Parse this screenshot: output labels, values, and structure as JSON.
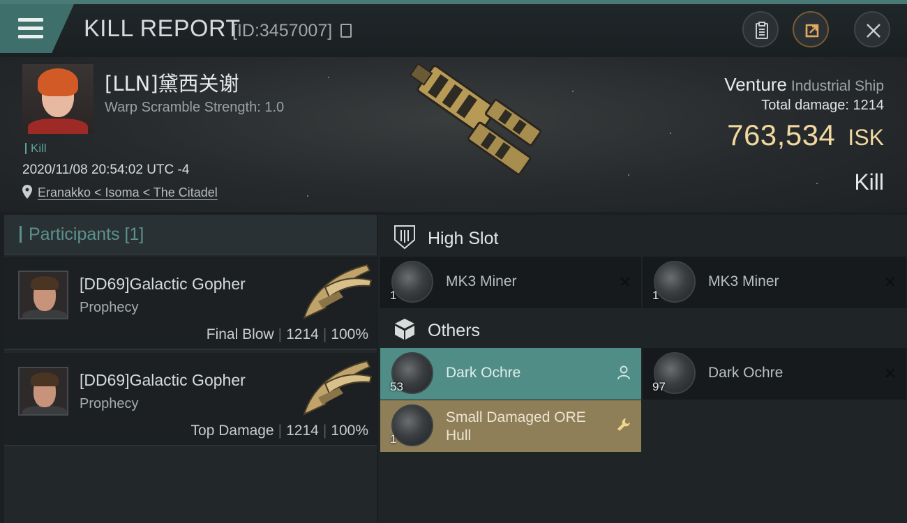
{
  "header": {
    "title": "KILL REPORT",
    "id_label": "[ID:3457007]"
  },
  "victim": {
    "name": "[LLN]黛西关谢",
    "warp_scramble": "Warp Scramble Strength: 1.0",
    "tag": "Kill",
    "datetime": "2020/11/08 20:54:02 UTC -4",
    "location": "Eranakko < Isoma < The Citadel",
    "ship_name": "Venture",
    "ship_class": "Industrial Ship",
    "total_damage_label": "Total damage:",
    "total_damage": "1214",
    "isk_value": "763,534",
    "isk_unit": "ISK",
    "status": "Kill"
  },
  "participants": {
    "title": "Participants [1]",
    "rows": [
      {
        "name": "[DD69]Galactic Gopher",
        "ship": "Prophecy",
        "role": "Final Blow",
        "damage": "1214",
        "percent": "100%"
      },
      {
        "name": "[DD69]Galactic Gopher",
        "ship": "Prophecy",
        "role": "Top Damage",
        "damage": "1214",
        "percent": "100%"
      }
    ]
  },
  "high_slot": {
    "label": "High Slot",
    "items": [
      {
        "name": "MK3 Miner",
        "qty": "1"
      },
      {
        "name": "MK3 Miner",
        "qty": "1"
      }
    ]
  },
  "others": {
    "label": "Others",
    "items": [
      {
        "name": "Dark Ochre",
        "qty": "53"
      },
      {
        "name": "Dark Ochre",
        "qty": "97"
      },
      {
        "name": "Small Damaged ORE",
        "name2": "Hull",
        "qty": "1"
      }
    ]
  },
  "colors": {
    "accent_teal": "#4f8d86",
    "isk_gold": "#f1d8a0",
    "dropped_gold": "#8f7f58"
  }
}
